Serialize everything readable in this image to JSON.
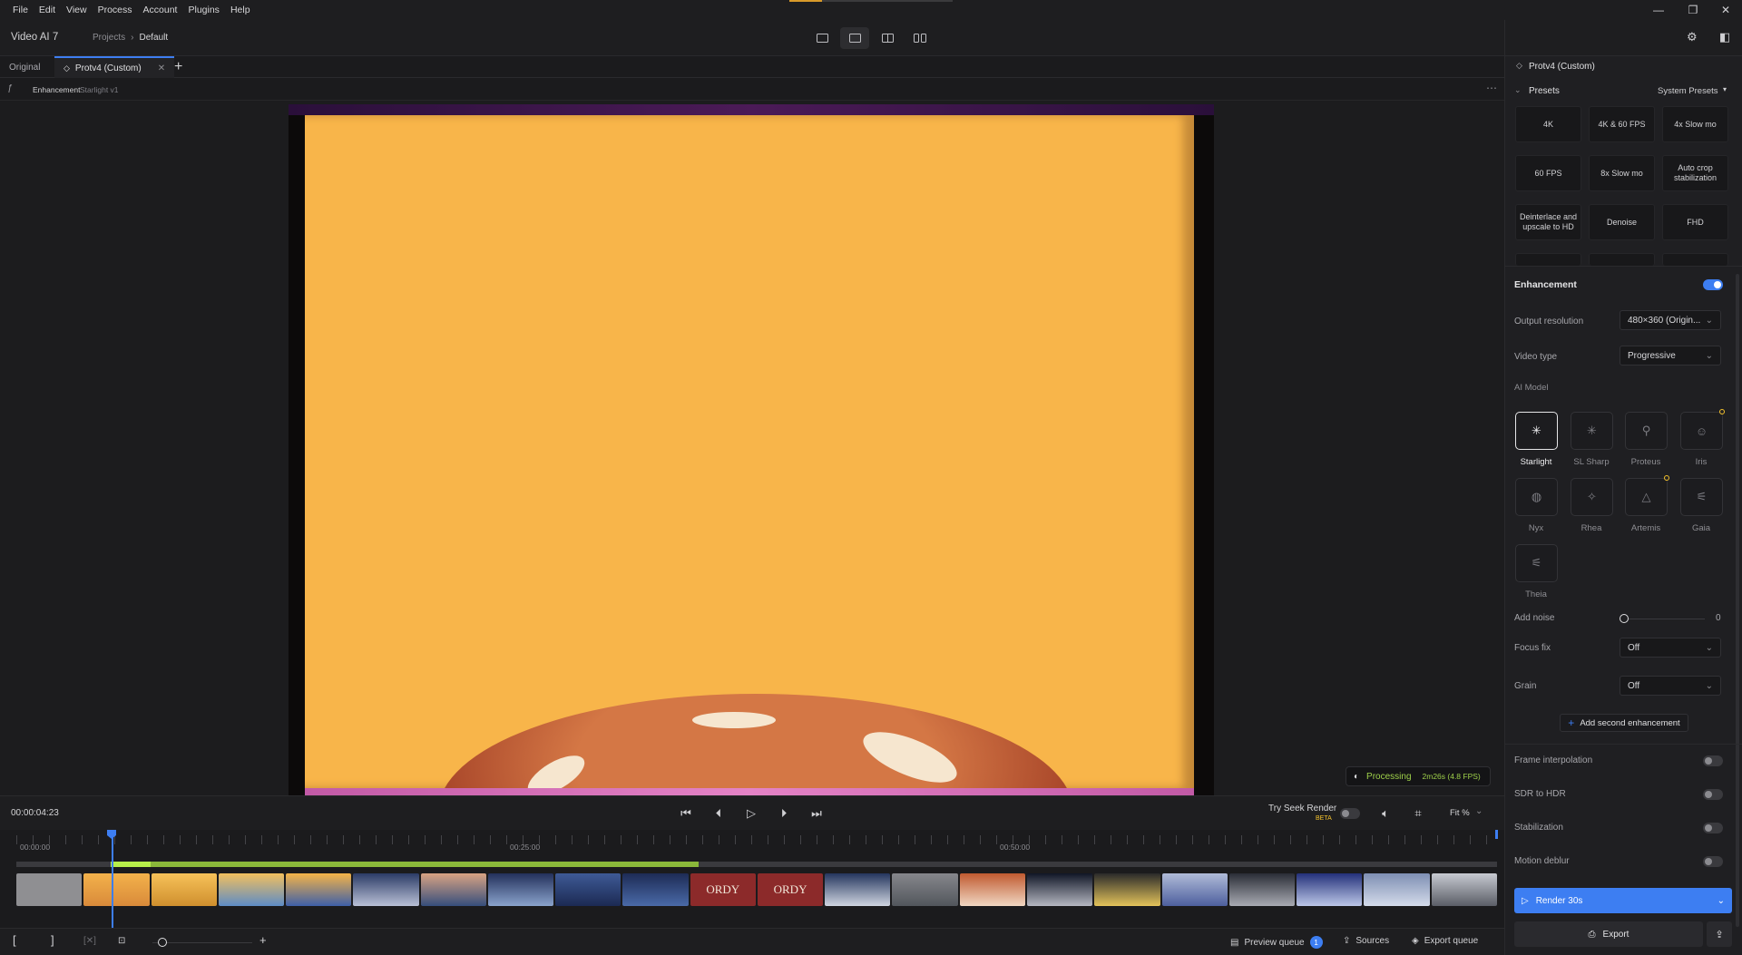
{
  "menubar": {
    "items": [
      "File",
      "Edit",
      "View",
      "Process",
      "Account",
      "Plugins",
      "Help"
    ],
    "window_controls": [
      "—",
      "❐",
      "✕"
    ]
  },
  "appbar": {
    "title": "Video AI 7",
    "breadcrumb": [
      "Projects",
      "Default"
    ]
  },
  "tabs": [
    {
      "label": "Original",
      "active": false
    },
    {
      "label": "Protv4 (Custom)",
      "active": true
    }
  ],
  "subbar": {
    "label": "Enhancement",
    "model": "Starlight v1"
  },
  "viewer": {
    "processing_label": "Processing",
    "processing_time": "2m26s (4.8 FPS)"
  },
  "transport": {
    "timecode": "00:00:04:23",
    "seek_label": "Try Seek Render",
    "seek_badge": "BETA",
    "fit_label": "Fit %"
  },
  "timeline": {
    "ruler": [
      "00:00:00",
      "00:25:00",
      "00:50:00"
    ],
    "thumb_texts": [
      "ORDY",
      "ORDY"
    ]
  },
  "bottombar": {
    "preview_queue": "Preview queue",
    "preview_count": "1",
    "sources": "Sources",
    "export_queue": "Export queue"
  },
  "panel": {
    "title": "Protv4 (Custom)",
    "presets_label": "Presets",
    "system_presets": "System Presets",
    "presets": [
      "4K",
      "4K & 60 FPS",
      "4x Slow mo",
      "60 FPS",
      "8x Slow mo",
      "Auto crop stabilization",
      "Deinterlace and upscale to HD",
      "Denoise",
      "FHD"
    ],
    "enhancement_label": "Enhancement",
    "output_resolution_label": "Output resolution",
    "output_resolution_value": "480×360 (Origin...",
    "video_type_label": "Video type",
    "video_type_value": "Progressive",
    "ai_model_label": "AI Model",
    "models": [
      {
        "name": "Starlight",
        "icon": "✳",
        "active": true
      },
      {
        "name": "SL Sharp",
        "icon": "✳",
        "active": false
      },
      {
        "name": "Proteus",
        "icon": "⚲",
        "active": false
      },
      {
        "name": "Iris",
        "icon": "☺",
        "active": false
      },
      {
        "name": "Nyx",
        "icon": "◍",
        "active": false
      },
      {
        "name": "Rhea",
        "icon": "✧",
        "active": false
      },
      {
        "name": "Artemis",
        "icon": "△",
        "active": false
      },
      {
        "name": "Gaia",
        "icon": "⚟",
        "active": false
      },
      {
        "name": "Theia",
        "icon": "⚟",
        "active": false
      }
    ],
    "add_noise_label": "Add noise",
    "add_noise_value": "0",
    "focus_fix_label": "Focus fix",
    "focus_fix_value": "Off",
    "grain_label": "Grain",
    "grain_value": "Off",
    "add_second_label": "Add second enhancement",
    "frame_interp_label": "Frame interpolation",
    "sdr_hdr_label": "SDR to HDR",
    "stabilization_label": "Stabilization",
    "motion_deblur_label": "Motion deblur",
    "render_label": "Render 30s",
    "export_label": "Export"
  },
  "colors": {
    "accent_blue": "#3d7ef2",
    "processing_green": "#9ed04a",
    "frame_yellow": "#f8b54a"
  }
}
